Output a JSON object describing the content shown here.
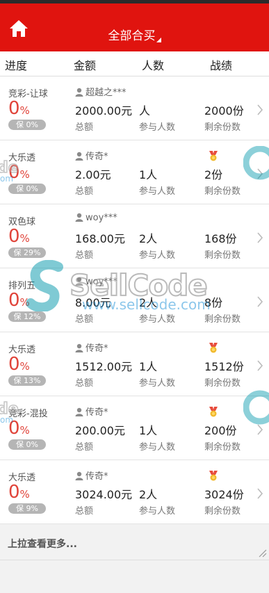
{
  "header": {
    "title": "全部合买",
    "home_icon": "home-icon",
    "bg_color": "#e0140f"
  },
  "columns": {
    "progress": "进度",
    "amount": "金额",
    "people": "人数",
    "record": "战绩"
  },
  "rows": [
    {
      "type": "竞彩-让球",
      "progress": "0",
      "progress_unit": "%",
      "guarantee": "保 0%",
      "user": "超越之***",
      "medal": false,
      "amount": "2000.00元",
      "people": "人",
      "share": "2000份",
      "amount_label": "总额",
      "people_label": "参与人数",
      "share_label": "剩余份数"
    },
    {
      "type": "大乐透",
      "progress": "0",
      "progress_unit": "%",
      "guarantee": "保 0%",
      "user": "传奇*",
      "medal": true,
      "amount": "2.00元",
      "people": "1人",
      "share": "2份",
      "amount_label": "总额",
      "people_label": "参与人数",
      "share_label": "剩余份数"
    },
    {
      "type": "双色球",
      "progress": "0",
      "progress_unit": "%",
      "guarantee": "保 29%",
      "user": "woy***",
      "medal": false,
      "amount": "168.00元",
      "people": "2人",
      "share": "168份",
      "amount_label": "总额",
      "people_label": "参与人数",
      "share_label": "剩余份数"
    },
    {
      "type": "排列五",
      "progress": "0",
      "progress_unit": "%",
      "guarantee": "保 12%",
      "user": "woy***",
      "medal": false,
      "amount": "8.00元",
      "people": "2人",
      "share": "8份",
      "amount_label": "总额",
      "people_label": "参与人数",
      "share_label": "剩余份数"
    },
    {
      "type": "大乐透",
      "progress": "0",
      "progress_unit": "%",
      "guarantee": "保 13%",
      "user": "传奇*",
      "medal": true,
      "amount": "1512.00元",
      "people": "1人",
      "share": "1512份",
      "amount_label": "总额",
      "people_label": "参与人数",
      "share_label": "剩余份数"
    },
    {
      "type": "竞彩-混投",
      "progress": "0",
      "progress_unit": "%",
      "guarantee": "保 0%",
      "user": "传奇*",
      "medal": true,
      "amount": "200.00元",
      "people": "1人",
      "share": "200份",
      "amount_label": "总额",
      "people_label": "参与人数",
      "share_label": "剩余份数"
    },
    {
      "type": "大乐透",
      "progress": "0",
      "progress_unit": "%",
      "guarantee": "保 9%",
      "user": "传奇*",
      "medal": true,
      "amount": "3024.00元",
      "people": "2人",
      "share": "3024份",
      "amount_label": "总额",
      "people_label": "参与人数",
      "share_label": "剩余份数"
    }
  ],
  "load_more": "上拉查看更多...",
  "watermark": {
    "logo": "SellCode",
    "url": "www.sellcode.com",
    "frag_logo": "de",
    "frag_url": "om"
  },
  "colors": {
    "accent": "#e0140f",
    "progress": "#e0443a",
    "badge": "#b5b5b5"
  }
}
